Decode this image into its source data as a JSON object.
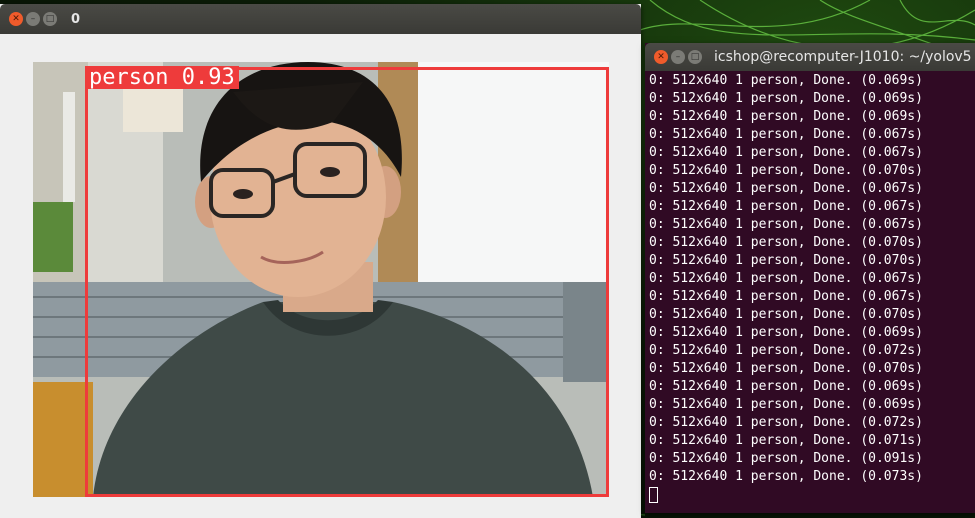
{
  "viewer": {
    "title": "0",
    "detection": {
      "label": "person 0.93"
    }
  },
  "terminal": {
    "title": "icshop@recomputer-J1010: ~/yolov5",
    "lines": [
      "0: 512x640 1 person, Done. (0.069s)",
      "0: 512x640 1 person, Done. (0.069s)",
      "0: 512x640 1 person, Done. (0.069s)",
      "0: 512x640 1 person, Done. (0.067s)",
      "0: 512x640 1 person, Done. (0.067s)",
      "0: 512x640 1 person, Done. (0.070s)",
      "0: 512x640 1 person, Done. (0.067s)",
      "0: 512x640 1 person, Done. (0.067s)",
      "0: 512x640 1 person, Done. (0.067s)",
      "0: 512x640 1 person, Done. (0.070s)",
      "0: 512x640 1 person, Done. (0.070s)",
      "0: 512x640 1 person, Done. (0.067s)",
      "0: 512x640 1 person, Done. (0.067s)",
      "0: 512x640 1 person, Done. (0.070s)",
      "0: 512x640 1 person, Done. (0.069s)",
      "0: 512x640 1 person, Done. (0.072s)",
      "0: 512x640 1 person, Done. (0.070s)",
      "0: 512x640 1 person, Done. (0.069s)",
      "0: 512x640 1 person, Done. (0.069s)",
      "0: 512x640 1 person, Done. (0.072s)",
      "0: 512x640 1 person, Done. (0.071s)",
      "0: 512x640 1 person, Done. (0.091s)",
      "0: 512x640 1 person, Done. (0.073s)"
    ]
  },
  "icons": {
    "close": "close-icon",
    "minimize": "minimize-icon",
    "maximize": "maximize-icon"
  },
  "colors": {
    "detection": "#ee3b3b",
    "terminal_bg": "#300a24",
    "close_button": "#f05b2b"
  }
}
